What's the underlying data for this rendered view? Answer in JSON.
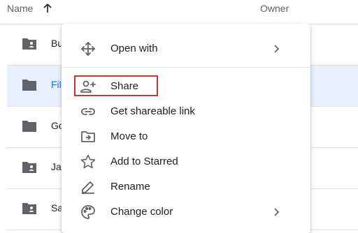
{
  "header": {
    "name_label": "Name",
    "owner_label": "Owner"
  },
  "rows": [
    {
      "name": "Bu",
      "icon": "shared-folder-icon"
    },
    {
      "name": "Fil",
      "icon": "folder-icon"
    },
    {
      "name": "Go",
      "icon": "folder-icon"
    },
    {
      "name": "Ja",
      "icon": "shared-folder-icon"
    },
    {
      "name": "Sa",
      "icon": "shared-folder-icon"
    }
  ],
  "menu": {
    "items": [
      {
        "label": "Open with",
        "icon": "move-arrows-icon",
        "submenu": true
      },
      {
        "label": "Share",
        "icon": "add-person-icon"
      },
      {
        "label": "Get shareable link",
        "icon": "link-icon"
      },
      {
        "label": "Move to",
        "icon": "move-to-folder-icon"
      },
      {
        "label": "Add to Starred",
        "icon": "star-icon"
      },
      {
        "label": "Rename",
        "icon": "pencil-icon"
      },
      {
        "label": "Change color",
        "icon": "palette-icon",
        "submenu": true
      }
    ]
  },
  "colors": {
    "highlight": "#c0392b",
    "selected_row": "#e8f0fe",
    "icon": "#5f6368"
  }
}
